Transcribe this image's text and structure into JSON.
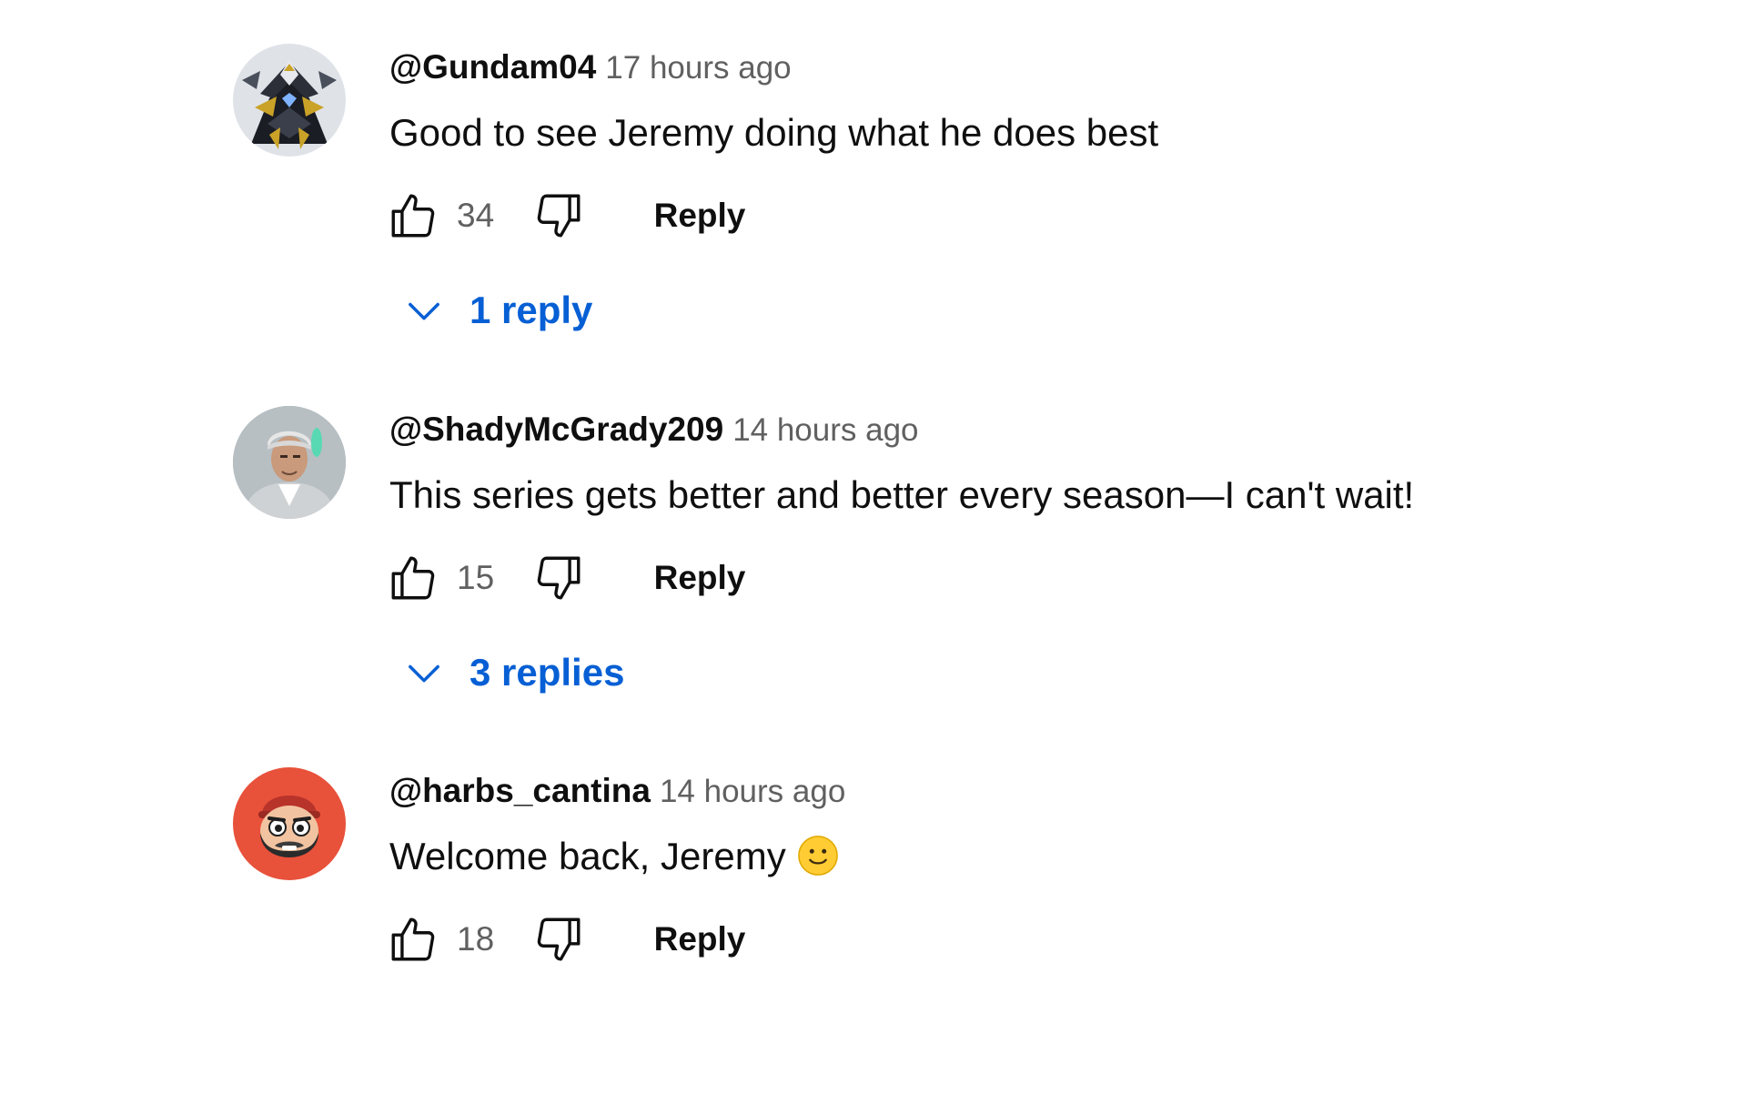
{
  "comments": [
    {
      "author": "@Gundam04",
      "time": "17 hours ago",
      "text": "Good to see Jeremy doing what he does best",
      "likes": "34",
      "reply_label": "Reply",
      "replies_label": "1 reply",
      "avatar_icon": "robot-mecha-avatar"
    },
    {
      "author": "@ShadyMcGrady209",
      "time": "14 hours ago",
      "text": "This series gets better and better every season—I can't wait!",
      "likes": "15",
      "reply_label": "Reply",
      "replies_label": "3 replies",
      "avatar_icon": "person-photo-avatar"
    },
    {
      "author": "@harbs_cantina",
      "time": "14 hours ago",
      "text": "Welcome back, Jeremy",
      "likes": "18",
      "reply_label": "Reply",
      "avatar_icon": "cartoon-bearded-man-avatar"
    }
  ],
  "colors": {
    "link_blue": "#065fd4",
    "secondary_text": "#606060",
    "primary_text": "#0f0f0f"
  }
}
